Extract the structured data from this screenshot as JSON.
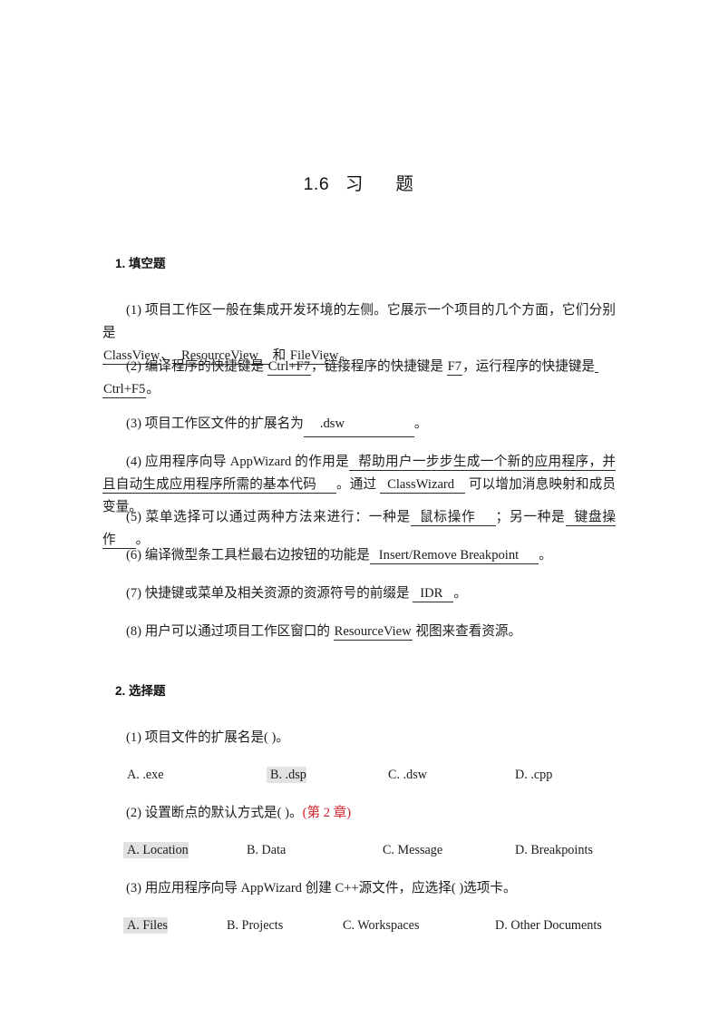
{
  "document": {
    "title": "1.6   习      题"
  },
  "sections": [
    {
      "heading": "1. 填空题",
      "questions": [
        {
          "num": "(1)",
          "part1": "项目工作区一般在集成开发环境的左侧。它展示一个项目的几个方面，它们分别是",
          "answers": [
            "ClassView",
            "ResourceView",
            "FileView"
          ],
          "sep1": "、",
          "mid": " 和 ",
          "end": "。"
        },
        {
          "num": "(2)",
          "part1": "编译程序的快捷键是 ",
          "a1": "Ctrl+F7",
          "part2": "，链接程序的快捷键是 ",
          "a2": "F7",
          "part3": "，运行程序的快捷键是",
          "a3": "Ctrl+F5",
          "end": "。"
        },
        {
          "num": "(3)",
          "part1": "项目工作区文件的扩展名为",
          "a1": ".dsw",
          "end": "。"
        },
        {
          "num": "(4)",
          "part1": "应用程序向导 AppWizard 的作用是",
          "a1": "帮助用户一步步生成一个新的应用程序，并且自动生成应用程序所需的基本代码",
          "part2": "。通过 ",
          "a2": "ClassWizard",
          "part3": " 可以增加消息映射和成员变量。"
        },
        {
          "num": "(5)",
          "part1": "菜单选择可以通过两种方法来进行：一种是",
          "a1": "鼠标操作",
          "part2": "；另一种是",
          "a2": "键盘操作",
          "end": "。"
        },
        {
          "num": "(6)",
          "part1": "编译微型条工具栏最右边按钮的功能是",
          "a1": "Insert/Remove Breakpoint",
          "end": "。"
        },
        {
          "num": "(7)",
          "part1": "快捷键或菜单及相关资源的资源符号的前缀是 ",
          "a1": "IDR",
          "end": "。"
        },
        {
          "num": "(8)",
          "part1": "用户可以通过项目工作区窗口的 ",
          "a1": "ResourceView",
          "part2": " 视图来查看资源。"
        }
      ]
    },
    {
      "heading": "2. 选择题",
      "questions": [
        {
          "num": "(1)",
          "text": "项目文件的扩展名是(      )。",
          "note": "",
          "choices": [
            "A. .exe",
            "B. .dsp",
            "C. .dsw",
            "D. .cpp"
          ],
          "highlight_index": 1
        },
        {
          "num": "(2)",
          "text": "设置断点的默认方式是(      )。",
          "note": "(第 2 章)",
          "choices": [
            "A. Location",
            "B. Data",
            "C. Message",
            "D. Breakpoints"
          ],
          "highlight_index": 0
        },
        {
          "num": "(3)",
          "text": "用应用程序向导 AppWizard 创建 C++源文件，应选择(      )选项卡。",
          "note": "",
          "choices": [
            "A. Files",
            "B. Projects",
            "C. Workspaces",
            "D. Other Documents"
          ],
          "highlight_index": 0
        }
      ]
    }
  ],
  "colors": {
    "note_red": "#d02028",
    "highlight_gray": "#e2e2e2",
    "text": "#1c1c1c"
  }
}
